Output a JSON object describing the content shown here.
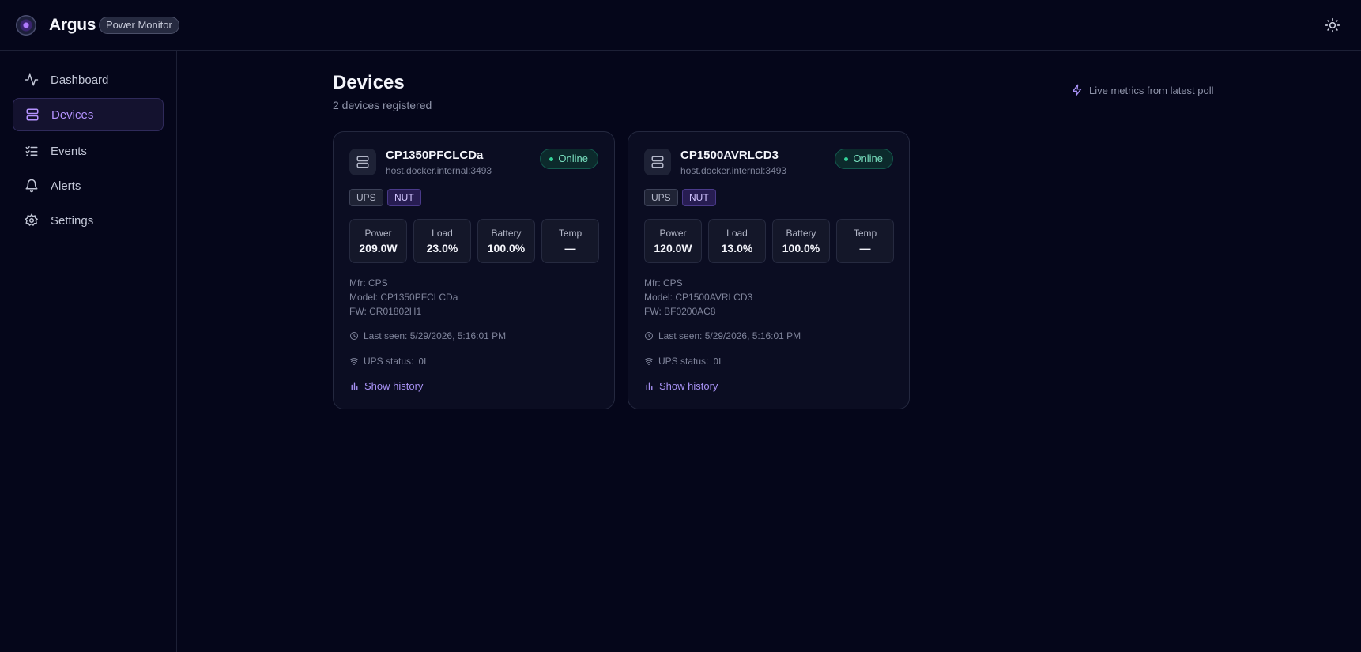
{
  "app": {
    "brand": "Argus",
    "badge": "Power Monitor"
  },
  "sidebar": {
    "items": [
      {
        "label": "Dashboard",
        "icon": "activity-icon"
      },
      {
        "label": "Devices",
        "icon": "server-icon",
        "active": true
      },
      {
        "label": "Events",
        "icon": "list-checks-icon"
      },
      {
        "label": "Alerts",
        "icon": "bell-icon"
      },
      {
        "label": "Settings",
        "icon": "gear-icon"
      }
    ]
  },
  "page": {
    "title": "Devices",
    "subtitle": "2 devices registered",
    "live_note": "Live metrics from latest poll"
  },
  "devices": [
    {
      "name": "CP1350PFCLCDa",
      "host": "host.docker.internal:3493",
      "status": "Online",
      "tags": [
        "UPS",
        "NUT"
      ],
      "metrics": [
        {
          "label": "Power",
          "value": "209.0W"
        },
        {
          "label": "Load",
          "value": "23.0%"
        },
        {
          "label": "Battery",
          "value": "100.0%"
        },
        {
          "label": "Temp",
          "value": "—"
        }
      ],
      "mfr": "Mfr: CPS",
      "model": "Model: CP1350PFCLCDa",
      "fw": "FW: CR01802H1",
      "last_seen": "Last seen: 5/29/2026, 5:16:01 PM",
      "ups_status_label": "UPS status:",
      "ups_status_value": "OL",
      "history_label": "Show history"
    },
    {
      "name": "CP1500AVRLCD3",
      "host": "host.docker.internal:3493",
      "status": "Online",
      "tags": [
        "UPS",
        "NUT"
      ],
      "metrics": [
        {
          "label": "Power",
          "value": "120.0W"
        },
        {
          "label": "Load",
          "value": "13.0%"
        },
        {
          "label": "Battery",
          "value": "100.0%"
        },
        {
          "label": "Temp",
          "value": "—"
        }
      ],
      "mfr": "Mfr: CPS",
      "model": "Model: CP1500AVRLCD3",
      "fw": "FW: BF0200AC8",
      "last_seen": "Last seen: 5/29/2026, 5:16:01 PM",
      "ups_status_label": "UPS status:",
      "ups_status_value": "OL",
      "history_label": "Show history"
    }
  ],
  "colors": {
    "background": "#05061a",
    "accent": "#b493ff",
    "online": "#34d399"
  }
}
